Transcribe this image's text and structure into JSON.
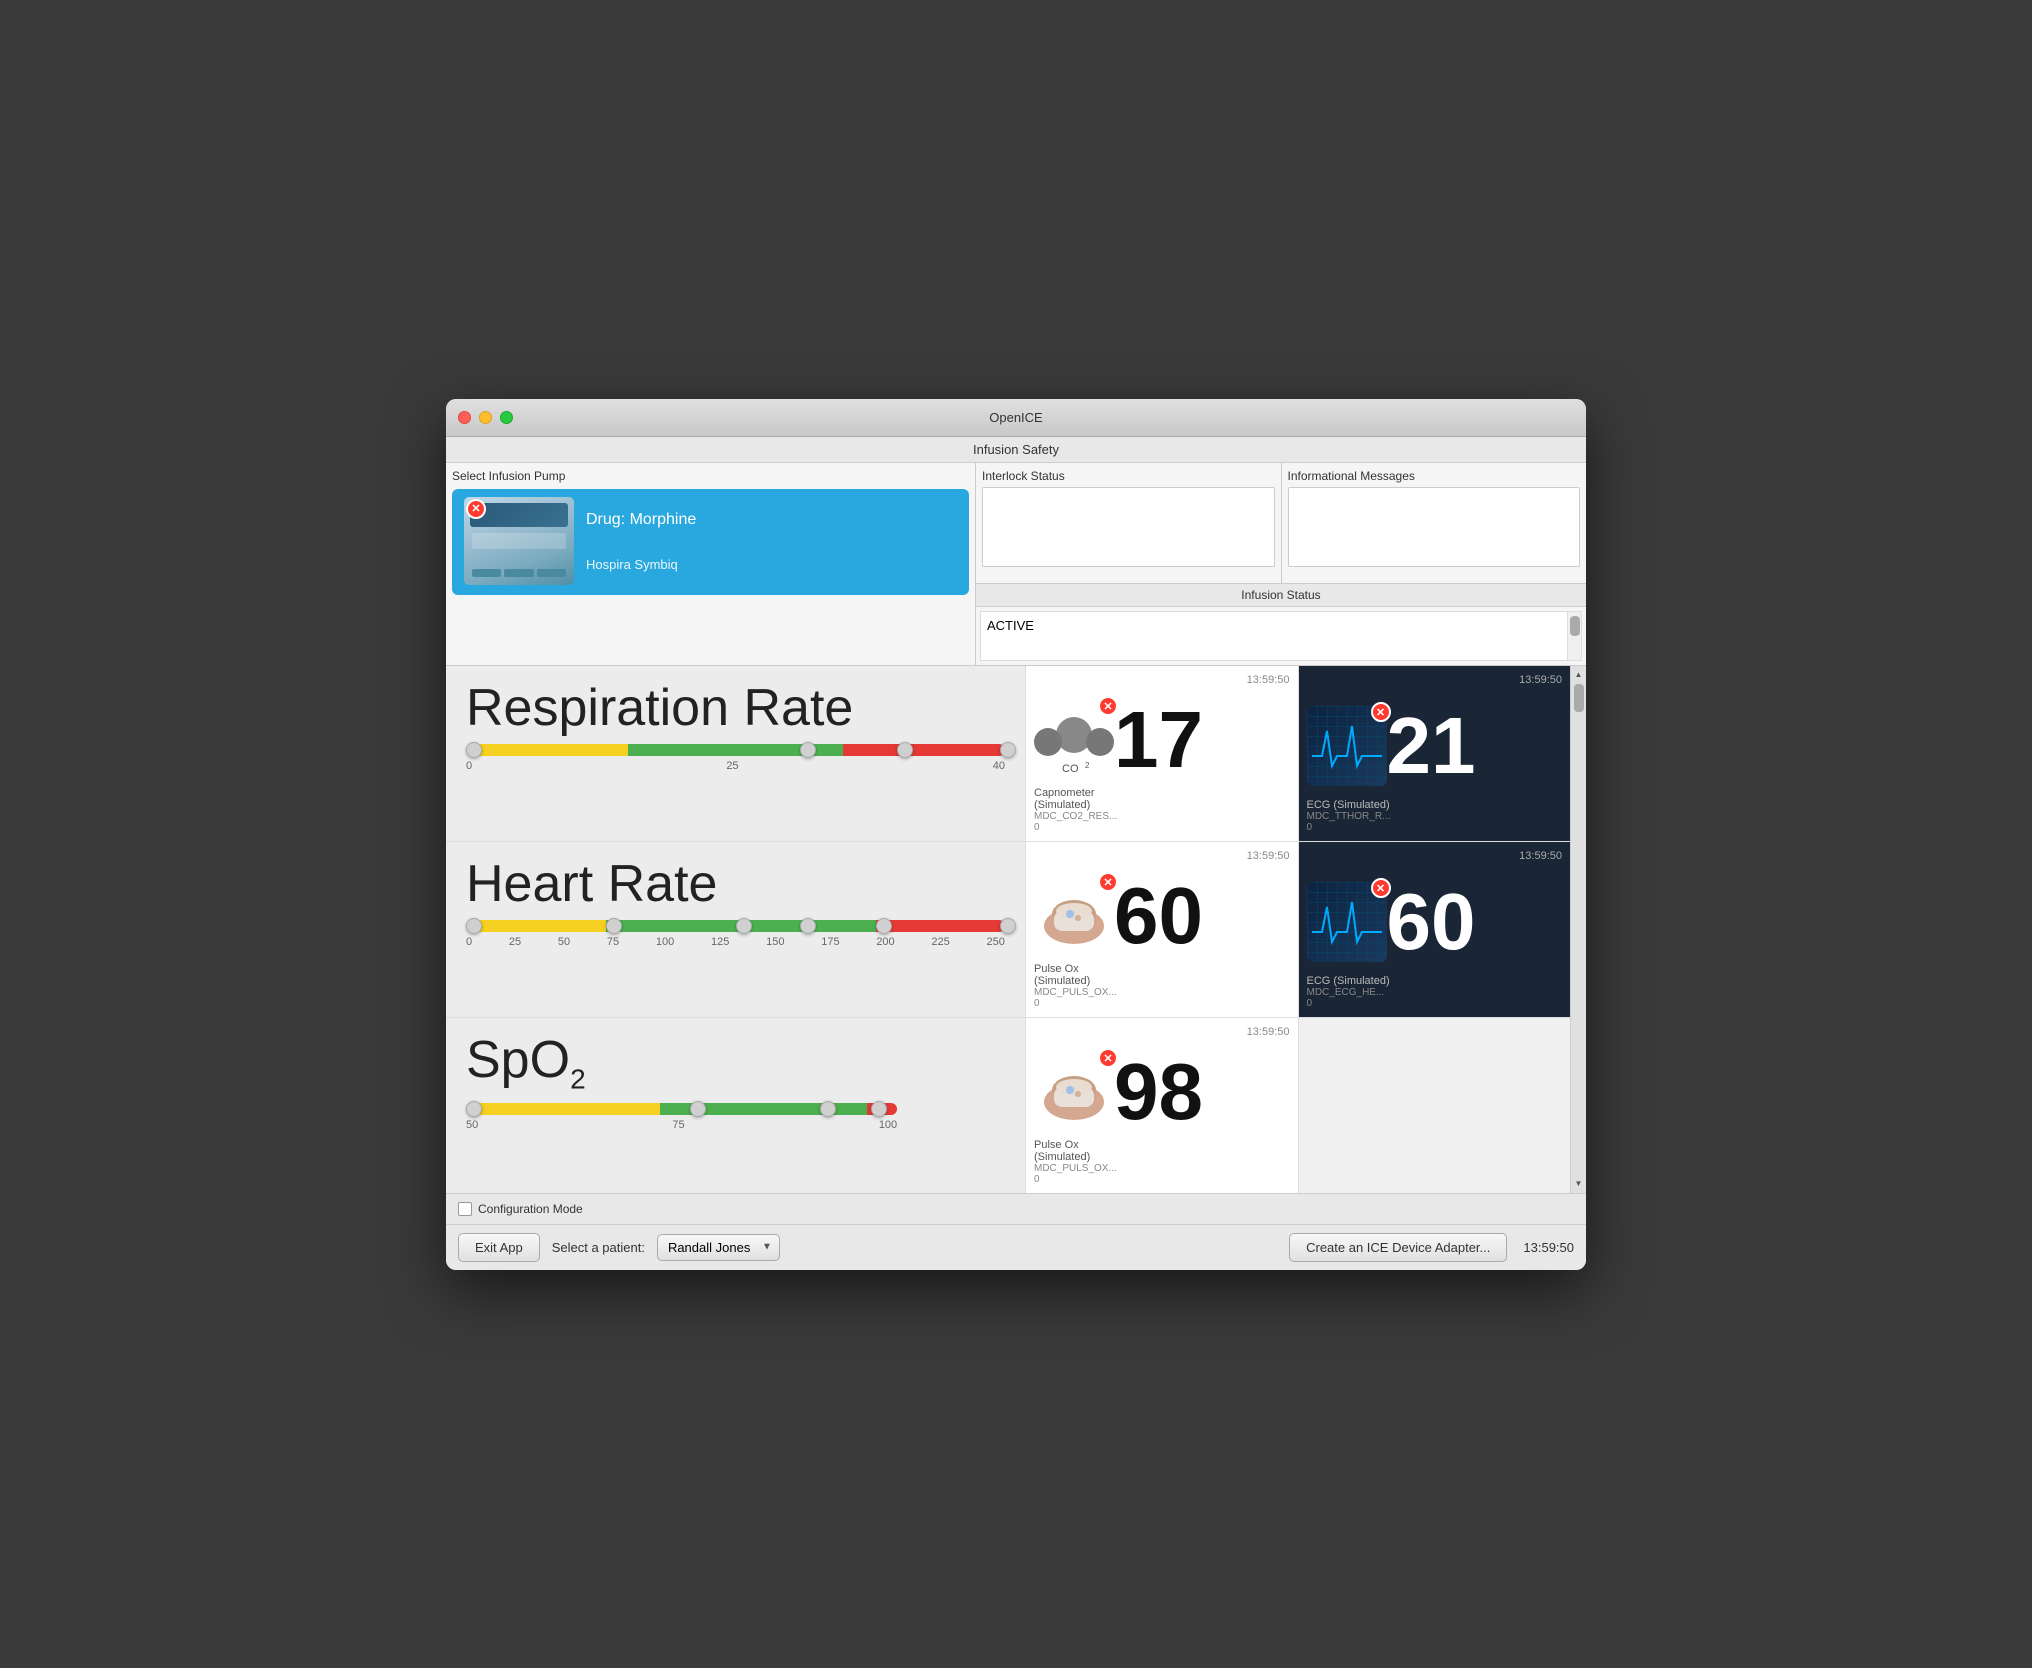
{
  "window": {
    "title": "OpenICE",
    "subtitle": "Infusion Safety"
  },
  "pump_panel": {
    "header": "Select Infusion Pump",
    "pump": {
      "drug": "Drug: Morphine",
      "name": "Hospira Symbiq"
    }
  },
  "status_panel": {
    "interlock_header": "Interlock Status",
    "informational_header": "Informational Messages",
    "infusion_header": "Infusion Status",
    "infusion_value": "ACTIVE"
  },
  "vitals": [
    {
      "title": "Respiration Rate",
      "slider": {
        "segments": [
          30,
          40,
          30
        ],
        "thumbs": [
          0,
          62,
          78,
          100
        ],
        "labels": [
          "0",
          "25",
          "40"
        ]
      },
      "sensors": [
        {
          "timestamp": "13:59:50",
          "type": "co2",
          "value": "17",
          "name": "Capnometer\n(Simulated)",
          "metric": "MDC_CO2_RES...\n0",
          "dark": false
        },
        {
          "timestamp": "13:59:50",
          "type": "ecg",
          "value": "21",
          "name": "ECG (Simulated)",
          "metric": "MDC_TTHOR_R...\n0",
          "dark": true
        }
      ]
    },
    {
      "title": "Heart Rate",
      "slider": {
        "segments": [
          30,
          48,
          22
        ],
        "thumbs": [
          0,
          10,
          20,
          30,
          48,
          58,
          70,
          82,
          92,
          100
        ],
        "labels": [
          "0",
          "25",
          "50",
          "75",
          "100",
          "125",
          "150",
          "175",
          "200",
          "225",
          "250"
        ]
      },
      "sensors": [
        {
          "timestamp": "13:59:50",
          "type": "pulseox",
          "value": "60",
          "name": "Pulse Ox\n(Simulated)",
          "metric": "MDC_PULS_OX...\n0",
          "dark": false
        },
        {
          "timestamp": "13:59:50",
          "type": "ecg",
          "value": "60",
          "name": "ECG (Simulated)",
          "metric": "MDC_ECG_HE...\n0",
          "dark": true
        }
      ]
    },
    {
      "title": "SpO2",
      "superscript": null,
      "slider": {
        "segments": [
          40,
          52,
          8
        ],
        "thumbs": [
          0,
          52,
          82,
          93,
          100
        ],
        "labels": [
          "50",
          "75",
          "100"
        ]
      },
      "sensors": [
        {
          "timestamp": "13:59:50",
          "type": "pulseox",
          "value": "98",
          "name": "Pulse Ox\n(Simulated)",
          "metric": "MDC_PULS_OX...\n0",
          "dark": false
        }
      ]
    }
  ],
  "footer": {
    "config_label": "Configuration Mode",
    "exit_label": "Exit App",
    "patient_label": "Select a patient:",
    "patient_value": "Randall Jones",
    "create_adapter_label": "Create an ICE Device Adapter...",
    "timestamp": "13:59:50"
  },
  "colors": {
    "accent_blue": "#29a8e0",
    "yellow": "#f5d020",
    "green": "#4caf50",
    "red": "#e53935",
    "error_red": "#ff3b30"
  }
}
